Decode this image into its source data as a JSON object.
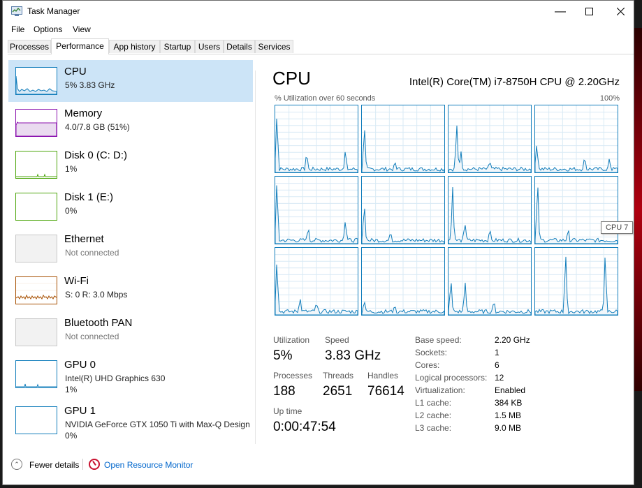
{
  "window": {
    "title": "Task Manager"
  },
  "menu": [
    "File",
    "Options",
    "View"
  ],
  "tabs": [
    "Processes",
    "Performance",
    "App history",
    "Startup",
    "Users",
    "Details",
    "Services"
  ],
  "active_tab": "Performance",
  "resources": [
    {
      "name": "CPU",
      "sub": "5% 3.83 GHz",
      "selected": true,
      "color": "#117dbb"
    },
    {
      "name": "Memory",
      "sub": "4.0/7.8 GB (51%)",
      "color": "#8b12ae"
    },
    {
      "name": "Disk 0 (C: D:)",
      "sub": "1%",
      "color": "#4da60c"
    },
    {
      "name": "Disk 1 (E:)",
      "sub": "0%",
      "color": "#4da60c"
    },
    {
      "name": "Ethernet",
      "sub": "Not connected",
      "color": "#a0a0a0"
    },
    {
      "name": "Wi-Fi",
      "sub": "S: 0 R: 3.0 Mbps",
      "color": "#a74f01"
    },
    {
      "name": "Bluetooth PAN",
      "sub": "Not connected",
      "color": "#a0a0a0"
    },
    {
      "name": "GPU 0",
      "sub": "Intel(R) UHD Graphics 630",
      "sub2": "1%",
      "color": "#117dbb"
    },
    {
      "name": "GPU 1",
      "sub": "NVIDIA GeForce GTX 1050 Ti with Max-Q Design",
      "sub2": "0%",
      "color": "#117dbb"
    }
  ],
  "cpu": {
    "title": "CPU",
    "model": "Intel(R) Core(TM) i7-8750H CPU @ 2.20GHz",
    "util_label": "% Utilization over 60 seconds",
    "util_max": "100%",
    "tooltip": "CPU 7",
    "stats": {
      "utilization_label": "Utilization",
      "utilization": "5%",
      "speed_label": "Speed",
      "speed": "3.83 GHz",
      "processes_label": "Processes",
      "processes": "188",
      "threads_label": "Threads",
      "threads": "2651",
      "handles_label": "Handles",
      "handles": "76614",
      "uptime_label": "Up time",
      "uptime": "0:00:47:54"
    },
    "specs": [
      {
        "label": "Base speed:",
        "value": "2.20 GHz"
      },
      {
        "label": "Sockets:",
        "value": "1"
      },
      {
        "label": "Cores:",
        "value": "6"
      },
      {
        "label": "Logical processors:",
        "value": "12"
      },
      {
        "label": "Virtualization:",
        "value": "Enabled"
      },
      {
        "label": "L1 cache:",
        "value": "384 KB"
      },
      {
        "label": "L2 cache:",
        "value": "1.5 MB"
      },
      {
        "label": "L3 cache:",
        "value": "9.0 MB"
      }
    ]
  },
  "footer": {
    "fewer": "Fewer details",
    "monitor": "Open Resource Monitor"
  },
  "icons": [
    "task-manager-icon",
    "minimize-icon",
    "maximize-icon",
    "close-icon",
    "chevron-up-icon",
    "resource-monitor-icon"
  ]
}
